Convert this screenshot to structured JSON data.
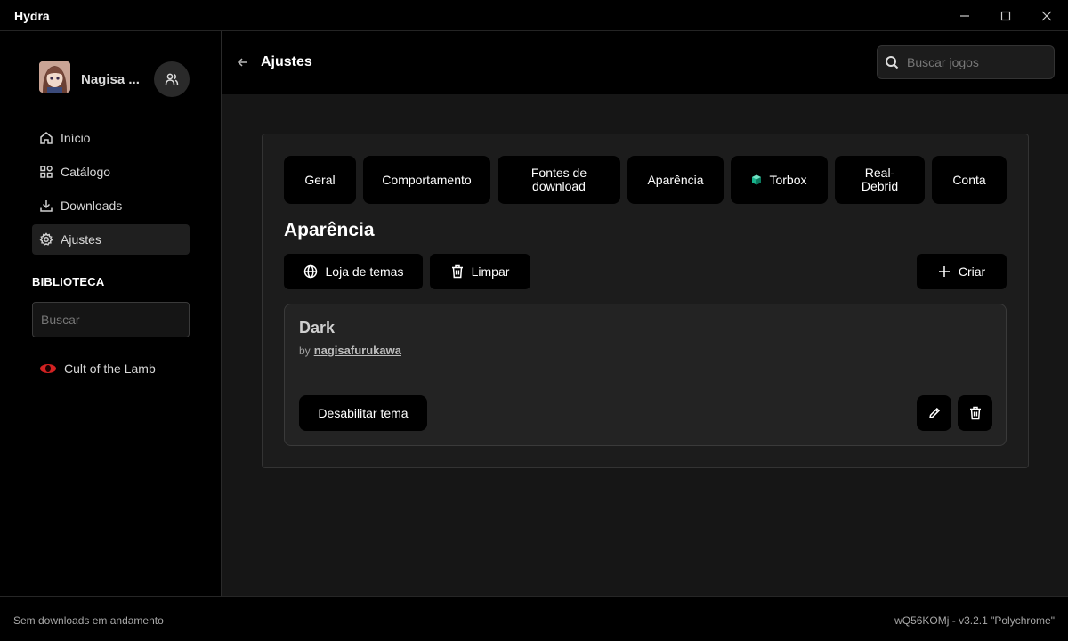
{
  "window": {
    "title": "Hydra"
  },
  "sidebar": {
    "profile": {
      "name": "Nagisa ..."
    },
    "nav": [
      {
        "label": "Início",
        "icon": "home-icon"
      },
      {
        "label": "Catálogo",
        "icon": "grid-icon"
      },
      {
        "label": "Downloads",
        "icon": "download-icon"
      },
      {
        "label": "Ajustes",
        "icon": "gear-icon",
        "active": true
      }
    ],
    "library": {
      "label": "BIBLIOTECA",
      "search_placeholder": "Buscar",
      "games": [
        {
          "name": "Cult of the Lamb",
          "icon_color": "#d32222"
        }
      ]
    }
  },
  "header": {
    "title": "Ajustes",
    "search_placeholder": "Buscar jogos"
  },
  "settings": {
    "tabs": [
      {
        "label": "Geral"
      },
      {
        "label": "Comportamento"
      },
      {
        "label": "Fontes de download"
      },
      {
        "label": "Aparência"
      },
      {
        "label": "Torbox",
        "icon_color": "#18b48c"
      },
      {
        "label": "Real-Debrid"
      },
      {
        "label": "Conta"
      }
    ],
    "section_title": "Aparência",
    "actions": {
      "theme_store": "Loja de temas",
      "clear": "Limpar",
      "create": "Criar"
    },
    "theme": {
      "name": "Dark",
      "by_label": "by",
      "author": "nagisafurukawa",
      "disable_label": "Desabilitar tema"
    }
  },
  "footer": {
    "status": "Sem downloads em andamento",
    "version": "wQ56KOMj - v3.2.1 \"Polychrome\""
  },
  "colors": {
    "background": "#000000",
    "content": "#161616",
    "panel": "#1c1c1c",
    "card": "#232323",
    "accent_game": "#d32222",
    "accent_torbox": "#18b48c"
  }
}
